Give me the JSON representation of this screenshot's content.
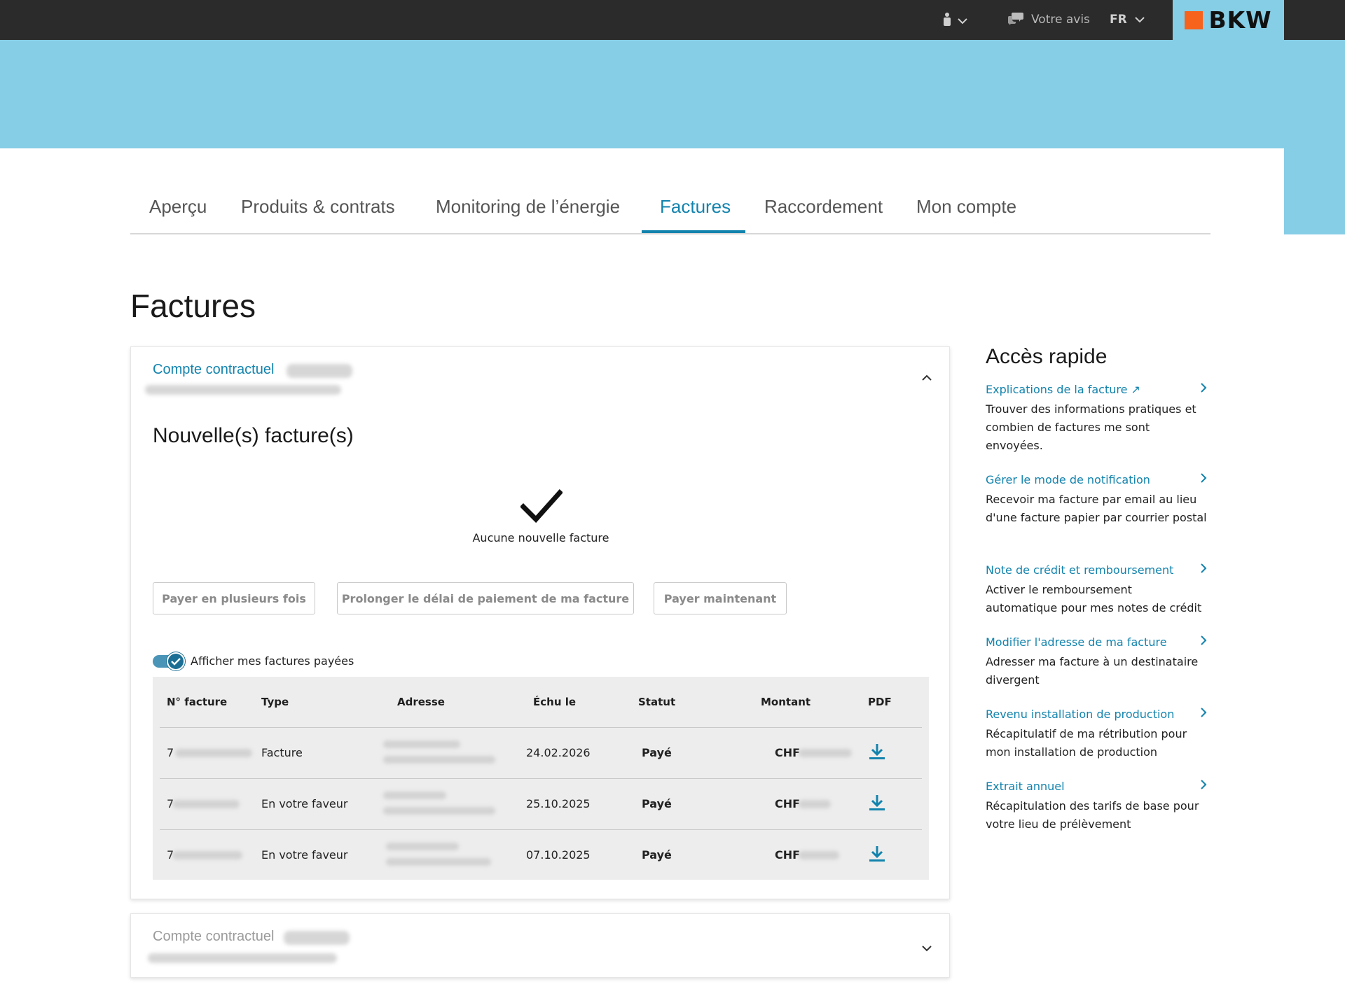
{
  "topbar": {
    "feedback_label": "Votre avis",
    "language": "FR",
    "logo_text": "BKW"
  },
  "tabs": [
    {
      "label": "Aperçu"
    },
    {
      "label": "Produits & contrats"
    },
    {
      "label": "Monitoring de l’énergie"
    },
    {
      "label": "Factures",
      "active": true
    },
    {
      "label": "Raccordement"
    },
    {
      "label": "Mon compte"
    }
  ],
  "page_title": "Factures",
  "account_card": {
    "label": "Compte contractuel",
    "section_title": "Nouvelle(s) facture(s)",
    "empty_state": "Aucune nouvelle facture",
    "buttons": {
      "pay_installments": "Payer en plusieurs fois",
      "extend_deadline": "Prolonger le délai de paiement de ma facture",
      "pay_now": "Payer maintenant"
    },
    "toggle": {
      "label": "Afficher mes factures payées",
      "checked": true
    },
    "table": {
      "headers": [
        "N° facture",
        "Type",
        "Adresse",
        "Échu le",
        "Statut",
        "Montant",
        "PDF"
      ],
      "rows": [
        {
          "number_prefix": "7",
          "type": "Facture",
          "due": "24.02.2026",
          "status": "Payé",
          "currency": "CHF"
        },
        {
          "number_prefix": "7",
          "type": "En votre faveur",
          "due": "25.10.2025",
          "status": "Payé",
          "currency": "CHF"
        },
        {
          "number_prefix": "7",
          "type": "En votre faveur",
          "due": "07.10.2025",
          "status": "Payé",
          "currency": "CHF"
        }
      ]
    }
  },
  "second_account": {
    "label": "Compte contractuel"
  },
  "quick_access": {
    "title": "Accès rapide",
    "items": [
      {
        "link": "Explications de la facture ↗",
        "desc": "Trouver des informations pratiques et combien de factures me sont envoyées."
      },
      {
        "link": "Gérer le mode de notification",
        "desc": "Recevoir ma facture par email au lieu d'une facture papier par courrier postal"
      },
      {
        "link": "Note de crédit et remboursement",
        "desc": "Activer le remboursement automatique pour mes notes de crédit"
      },
      {
        "link": "Modifier l'adresse de ma facture",
        "desc": "Adresser ma facture à un destinataire divergent"
      },
      {
        "link": "Revenu installation de production",
        "desc": "Récapitulatif de ma rétribution pour mon installation de production"
      },
      {
        "link": "Extrait annuel",
        "desc": "Récapitulation des tarifs de base pour votre lieu de prélèvement"
      }
    ]
  },
  "colors": {
    "accent": "#1283ad",
    "hero": "#86cde6",
    "topbar": "#2b2b2b",
    "logo_orange": "#f7621c"
  }
}
